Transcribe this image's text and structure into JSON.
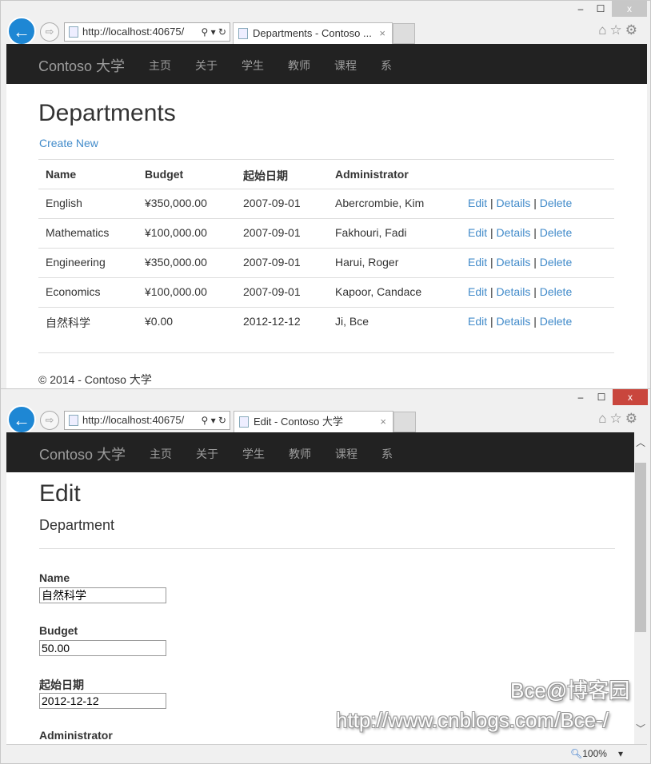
{
  "window1": {
    "url": "http://localhost:40675/",
    "tab_title": "Departments - Contoso ...",
    "url_tools": "⚲ ▾ ↻"
  },
  "window2": {
    "url": "http://localhost:40675/",
    "tab_title": "Edit - Contoso 大学",
    "zoom": "100%"
  },
  "nav": {
    "brand": "Contoso 大学",
    "items": [
      "主页",
      "关于",
      "学生",
      "教师",
      "课程",
      "系"
    ]
  },
  "departments": {
    "title": "Departments",
    "create_new": "Create New",
    "columns": [
      "Name",
      "Budget",
      "起始日期",
      "Administrator"
    ],
    "rows": [
      [
        "English",
        "¥350,000.00",
        "2007-09-01",
        "Abercrombie, Kim"
      ],
      [
        "Mathematics",
        "¥100,000.00",
        "2007-09-01",
        "Fakhouri, Fadi"
      ],
      [
        "Engineering",
        "¥350,000.00",
        "2007-09-01",
        "Harui, Roger"
      ],
      [
        "Economics",
        "¥100,000.00",
        "2007-09-01",
        "Kapoor, Candace"
      ],
      [
        "自然科学",
        "¥0.00",
        "2012-12-12",
        "Ji, Bce"
      ]
    ],
    "actions": {
      "edit": "Edit",
      "details": "Details",
      "delete": "Delete",
      "sep": " | "
    },
    "footer": "© 2014 - Contoso 大学"
  },
  "edit": {
    "title": "Edit",
    "subtitle": "Department",
    "fields": [
      {
        "label": "Name",
        "value": "自然科学"
      },
      {
        "label": "Budget",
        "value": "50.00"
      },
      {
        "label": "起始日期",
        "value": "2012-12-12"
      },
      {
        "label": "Administrator"
      }
    ]
  },
  "watermark": {
    "line1": "Bce@博客园",
    "line2": "http://www.cnblogs.com/Bce-/"
  },
  "icons": {
    "back": "←",
    "forward": "⇨",
    "home": "⌂",
    "star": "☆",
    "gear": "⚙",
    "minimize": "–",
    "maximize": "☐",
    "close": "x"
  }
}
